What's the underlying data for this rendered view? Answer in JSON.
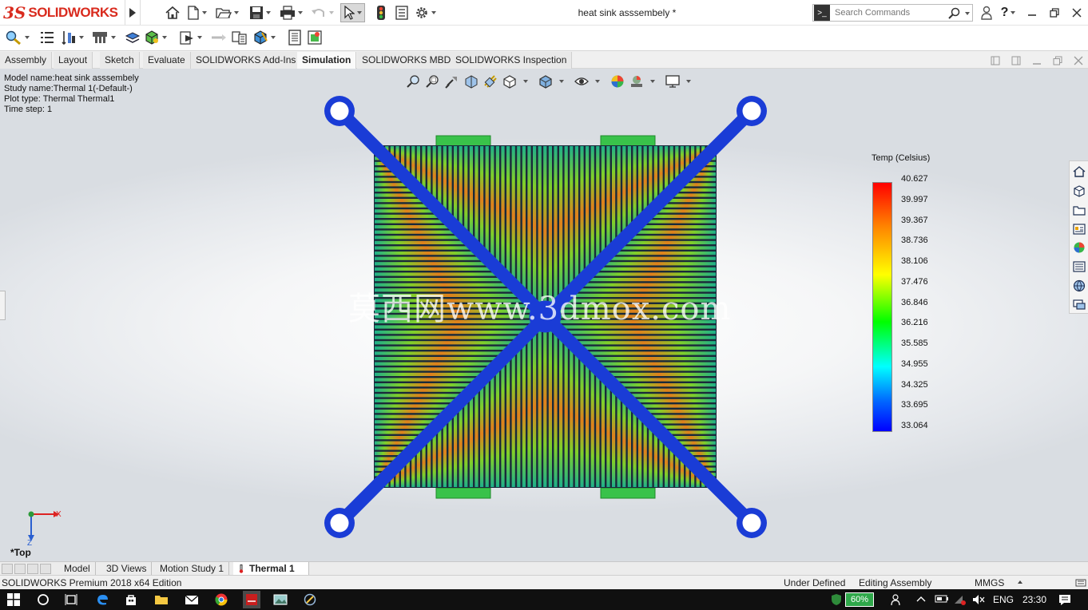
{
  "app": {
    "logo_ds": "3S",
    "logo_name": "SOLIDWORKS",
    "document_title": "heat sink asssembely *"
  },
  "search": {
    "placeholder": "Search Commands"
  },
  "tabs": [
    {
      "label": "Assembly"
    },
    {
      "label": "Layout"
    },
    {
      "label": "Sketch"
    },
    {
      "label": "Evaluate"
    },
    {
      "label": "SOLIDWORKS Add-Ins"
    },
    {
      "label": "Simulation",
      "active": true
    },
    {
      "label": "SOLIDWORKS MBD"
    },
    {
      "label": "SOLIDWORKS Inspection"
    }
  ],
  "model_info": {
    "model_name": "Model name:heat sink asssembely",
    "study_name": "Study name:Thermal 1(-Default-)",
    "plot_type": "Plot type: Thermal Thermal1",
    "time_step": "Time step: 1"
  },
  "legend": {
    "title": "Temp (Celsius)",
    "values": [
      "40.627",
      "39.997",
      "39.367",
      "38.736",
      "38.106",
      "37.476",
      "36.846",
      "36.216",
      "35.585",
      "34.955",
      "34.325",
      "33.695",
      "33.064"
    ],
    "colors": {
      "max": "#ff0000",
      "mid": "#00ff00",
      "min": "#0000ff"
    }
  },
  "watermark": "莫西网www.3dmox.com",
  "triad": {
    "x": "X",
    "z": "Z"
  },
  "view_name": "*Top",
  "bottom_tabs": [
    {
      "label": "Model"
    },
    {
      "label": "3D Views"
    },
    {
      "label": "Motion Study 1"
    },
    {
      "label": "Thermal 1",
      "active": true
    }
  ],
  "status": {
    "edition": "SOLIDWORKS Premium 2018 x64 Edition",
    "definition": "Under Defined",
    "mode": "Editing Assembly",
    "units": "MMGS"
  },
  "taskbar": {
    "battery": "60%",
    "language": "ENG",
    "time": "23:30"
  },
  "icons": [
    "home-icon",
    "new-doc-icon",
    "open-folder-icon",
    "save-icon",
    "print-icon",
    "undo-icon",
    "select-arrow-icon",
    "traffic-light-icon",
    "file-properties-icon",
    "gear-icon",
    "help-icon",
    "user-icon"
  ]
}
